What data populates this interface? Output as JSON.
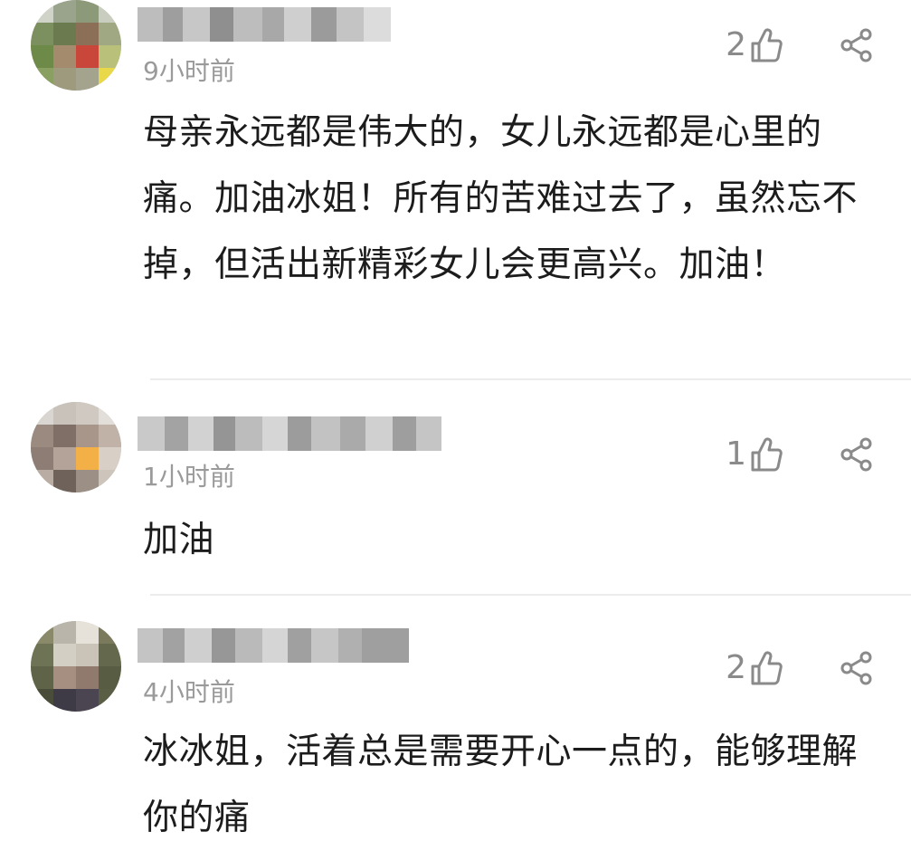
{
  "comments": [
    {
      "time": "9小时前",
      "likes": "2",
      "text": "母亲永远都是伟大的，女儿永远都是心里的痛。加油冰姐！所有的苦难过去了，虽然忘不掉，但活出新精彩女儿会更高兴。加油！"
    },
    {
      "time": "1小时前",
      "likes": "1",
      "text": "加油"
    },
    {
      "time": "4小时前",
      "likes": "2",
      "text": "冰冰姐，活着总是需要开心一点的，能够理解你的痛"
    }
  ],
  "icons": {
    "like": "thumbs-up-outline-icon",
    "share": "share-icon"
  },
  "colors": {
    "text": "#1c1c1c",
    "meta": "#9a9a9a",
    "icon": "#8a8a8a",
    "divider": "#ececec"
  }
}
